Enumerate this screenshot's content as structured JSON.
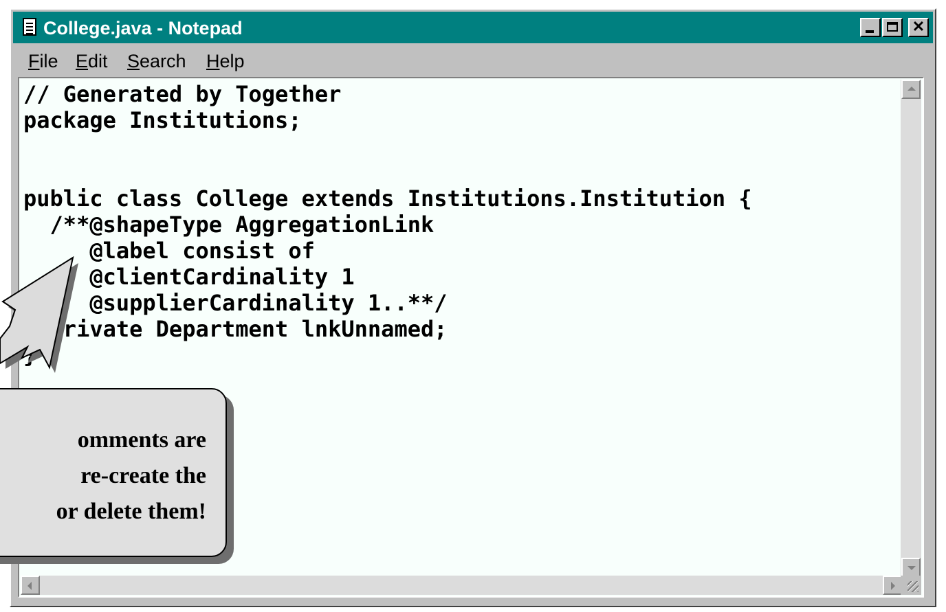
{
  "window": {
    "title": "College.java - Notepad"
  },
  "menu": {
    "items": [
      {
        "first": "F",
        "rest": "ile"
      },
      {
        "first": "E",
        "rest": "dit"
      },
      {
        "first": "S",
        "rest": "earch"
      },
      {
        "first": "H",
        "rest": "elp"
      }
    ]
  },
  "editor": {
    "code": "// Generated by Together\npackage Institutions;\n\n\npublic class College extends Institutions.Institution {\n  /**@shapeType AggregationLink\n     @label consist of\n     @clientCardinality 1\n     @supplierCardinality 1..**/\n  private Department lnkUnnamed;\n}"
  },
  "callout": {
    "text": "omments are\nre-create the\nor delete them!"
  },
  "colors": {
    "titlebar": "#008080",
    "window_face": "#c0c0c0",
    "editor_bg": "#f8fffc",
    "callout_bg": "#e0e0e0"
  }
}
